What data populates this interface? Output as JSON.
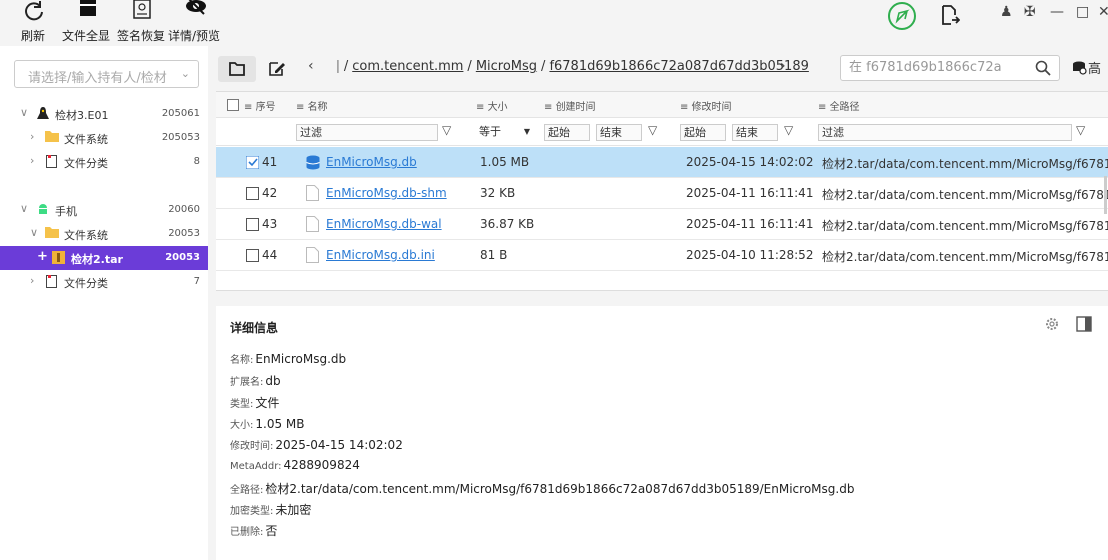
{
  "toolbar": {
    "refresh": "刷新",
    "file_full": "文件全显",
    "sign_recover": "签名恢复",
    "detail_preview": "详情/预览"
  },
  "left": {
    "owner_placeholder": "请选择/输入持有人/检材",
    "tree": [
      {
        "label": "检材3.E01",
        "count": "205061"
      },
      {
        "label": "文件系统",
        "count": "205053"
      },
      {
        "label": "文件分类",
        "count": "8"
      },
      {
        "label": "手机",
        "count": "20060"
      },
      {
        "label": "文件系统",
        "count": "20053"
      },
      {
        "label": "检材2.tar",
        "count": "20053"
      },
      {
        "label": "文件分类",
        "count": "7"
      }
    ]
  },
  "nav": {
    "crumb_prefix": "ǀ",
    "crumbs": [
      "com.tencent.mm",
      "MicroMsg",
      "f6781d69b1866c72a087d67dd3b05189"
    ],
    "search_placeholder": "在 f6781d69b1866c72a",
    "adv_label": "高"
  },
  "table": {
    "headers": [
      "序号",
      "名称",
      "大小",
      "创建时间",
      "修改时间",
      "全路径"
    ],
    "filters": {
      "name": "过滤",
      "size_op": "等于",
      "created_start": "起始",
      "created_end": "结束",
      "modified_start": "起始",
      "modified_end": "结束",
      "path": "过滤"
    },
    "rows": [
      {
        "idx": "41",
        "name": "EnMicroMsg.db",
        "size": "1.05 MB",
        "mtime": "2025-04-15 14:02:02",
        "path": "检材2.tar/data/com.tencent.mm/MicroMsg/f6781..."
      },
      {
        "idx": "42",
        "name": "EnMicroMsg.db-shm",
        "size": "32 KB",
        "mtime": "2025-04-11 16:11:41",
        "path": "检材2.tar/data/com.tencent.mm/MicroMsg/f6781..."
      },
      {
        "idx": "43",
        "name": "EnMicroMsg.db-wal",
        "size": "36.87 KB",
        "mtime": "2025-04-11 16:11:41",
        "path": "检材2.tar/data/com.tencent.mm/MicroMsg/f6781..."
      },
      {
        "idx": "44",
        "name": "EnMicroMsg.db.ini",
        "size": "81 B",
        "mtime": "2025-04-10 11:28:52",
        "path": "检材2.tar/data/com.tencent.mm/MicroMsg/f6781..."
      }
    ]
  },
  "detail": {
    "title": "详细信息",
    "fields": [
      {
        "k": "名称:",
        "v": "EnMicroMsg.db"
      },
      {
        "k": "扩展名:",
        "v": "db"
      },
      {
        "k": "类型:",
        "v": "文件"
      },
      {
        "k": "大小:",
        "v": "1.05 MB"
      },
      {
        "k": "修改时间:",
        "v": "2025-04-15 14:02:02"
      },
      {
        "k": "MetaAddr:",
        "v": "4288909824"
      },
      {
        "k": "全路径:",
        "v": "检材2.tar/data/com.tencent.mm/MicroMsg/f6781d69b1866c72a087d67dd3b05189/EnMicroMsg.db"
      },
      {
        "k": "加密类型:",
        "v": "未加密"
      },
      {
        "k": "已删除:",
        "v": "否"
      }
    ]
  },
  "colors": {
    "accent": "#6b3cd8",
    "selection": "#bde0f8",
    "link": "#2a7ad4",
    "send": "#2fae4e"
  }
}
